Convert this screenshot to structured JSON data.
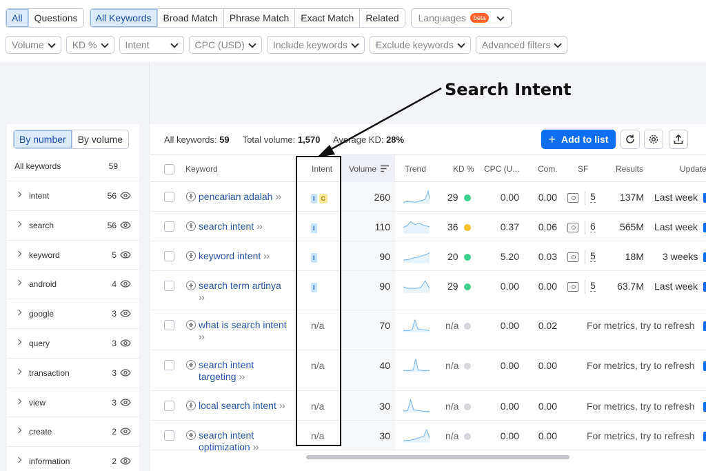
{
  "filters_row1": {
    "group1": [
      "All",
      "Questions"
    ],
    "group2": [
      "All Keywords",
      "Broad Match",
      "Phrase Match",
      "Exact Match",
      "Related"
    ],
    "languages_label": "Languages",
    "beta_badge": "beta"
  },
  "filters_row2": [
    "Volume",
    "KD %",
    "Intent",
    "CPC (USD)",
    "Include keywords",
    "Exclude keywords",
    "Advanced filters"
  ],
  "sidebar": {
    "toggle": [
      "By number",
      "By volume"
    ],
    "header_label": "All keywords",
    "header_count": "59",
    "items": [
      {
        "label": "intent",
        "count": "56"
      },
      {
        "label": "search",
        "count": "56"
      },
      {
        "label": "keyword",
        "count": "5"
      },
      {
        "label": "android",
        "count": "4"
      },
      {
        "label": "google",
        "count": "3"
      },
      {
        "label": "query",
        "count": "3"
      },
      {
        "label": "transaction",
        "count": "3"
      },
      {
        "label": "view",
        "count": "3"
      },
      {
        "label": "create",
        "count": "2"
      },
      {
        "label": "information",
        "count": "2"
      }
    ]
  },
  "summary": {
    "all_keywords_label": "All keywords:",
    "all_keywords_value": "59",
    "total_volume_label": "Total volume:",
    "total_volume_value": "1,570",
    "avg_kd_label": "Average KD:",
    "avg_kd_value": "28%"
  },
  "add_button_label": "Add to list",
  "columns": [
    "Keyword",
    "Intent",
    "Volume",
    "Trend",
    "KD %",
    "CPC (U...",
    "Com.",
    "SF",
    "Results",
    "Update"
  ],
  "rows": [
    {
      "kw1": "pencarian adalah",
      "kw2": "",
      "intent": [
        "I",
        "C"
      ],
      "volume": "260",
      "kd": "29",
      "kd_color": "#3fcf8e",
      "cpc": "0.00",
      "com": "0.00",
      "sf": "5",
      "results": "137M",
      "update": "Last week"
    },
    {
      "kw1": "search intent",
      "kw2": "",
      "intent": [
        "I"
      ],
      "volume": "110",
      "kd": "36",
      "kd_color": "#f7c12b",
      "cpc": "0.37",
      "com": "0.06",
      "sf": "6",
      "results": "565M",
      "update": "Last week"
    },
    {
      "kw1": "keyword intent",
      "kw2": "",
      "intent": [
        "I"
      ],
      "volume": "90",
      "kd": "20",
      "kd_color": "#3fcf8e",
      "cpc": "5.20",
      "com": "0.03",
      "sf": "5",
      "results": "18M",
      "update": "3 weeks"
    },
    {
      "kw1": "search term artinya",
      "kw2": "",
      "intent": [
        "I"
      ],
      "volume": "90",
      "kd": "29",
      "kd_color": "#3fcf8e",
      "cpc": "0.00",
      "com": "0.00",
      "sf": "5",
      "results": "63.7M",
      "update": "Last week"
    },
    {
      "kw1": "what is search intent",
      "kw2": "",
      "intent_na": "n/a",
      "volume": "70",
      "kd": "n/a",
      "cpc": "0.00",
      "com": "0.02",
      "refresh": "For metrics, try to refresh"
    },
    {
      "kw1": "search intent",
      "kw2": "targeting",
      "intent_na": "n/a",
      "volume": "40",
      "kd": "n/a",
      "cpc": "0.00",
      "com": "0.00",
      "refresh": "For metrics, try to refresh"
    },
    {
      "kw1": "local search intent",
      "kw2": "",
      "intent_na": "n/a",
      "volume": "30",
      "kd": "n/a",
      "cpc": "0.00",
      "com": "0.00",
      "refresh": "For metrics, try to refresh"
    },
    {
      "kw1": "search intent",
      "kw2": "optimization",
      "intent_na": "n/a",
      "volume": "30",
      "kd": "n/a",
      "cpc": "0.00",
      "com": "0.00",
      "refresh": "For metrics, try to refresh"
    }
  ],
  "annotation": {
    "label": "Search  Intent"
  },
  "colors": {
    "accent_blue": "#0e6ef0",
    "link_blue": "#2a55a8",
    "kd_green": "#3fcf8e",
    "kd_yellow": "#f7c12b",
    "kd_gray": "#d6d8dd"
  },
  "icons": [
    "chevron-down-icon",
    "eye-icon",
    "refresh-icon",
    "gear-icon",
    "export-icon",
    "plus-circle-icon",
    "sort-icon",
    "serp-icon"
  ]
}
